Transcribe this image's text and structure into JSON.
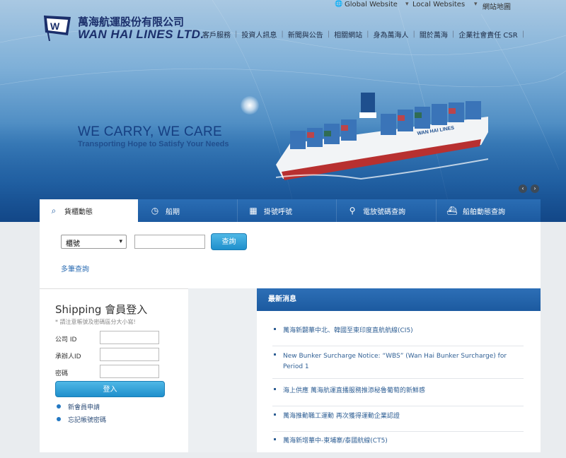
{
  "brand": {
    "name_cn": "萬海航運股份有限公司",
    "name_en": "WAN HAI LINES LTD."
  },
  "utility": {
    "global": "Global Website",
    "local": "Local Websites",
    "sitemap": "網站地圖"
  },
  "nav": [
    "客戶服務",
    "投資人訊息",
    "新聞與公告",
    "相關網站",
    "身為萬海人",
    "關於萬海",
    "企業社會責任 CSR"
  ],
  "hero": {
    "tagline": "WE CARRY, WE CARE",
    "subtagline": "Transporting Hope to Satisfy Your Needs",
    "ship_label": "WAN HAI LINES",
    "prev": "‹",
    "next": "›"
  },
  "tabs": [
    {
      "label": "貨櫃動態",
      "icon": "container-search-icon"
    },
    {
      "label": "船期",
      "icon": "clock-icon"
    },
    {
      "label": "掛號呼號",
      "icon": "grid-icon"
    },
    {
      "label": "電放號碼查詢",
      "icon": "magnifier-icon"
    },
    {
      "label": "船舶動態查詢",
      "icon": "ship-icon"
    }
  ],
  "search": {
    "select_value": "櫃號",
    "input_value": "",
    "button": "查詢",
    "multi_link": "多筆查詢"
  },
  "login": {
    "title": "Shipping 會員登入",
    "note": "* 請注意帳號及密碼區分大小寫!",
    "company_label": "公司 ID",
    "user_label": "承辦人ID",
    "password_label": "密碼",
    "button": "登入",
    "register": "新會員申請",
    "forgot": "忘記帳號密碼"
  },
  "news": {
    "title": "最新消息",
    "items": [
      "萬海新闢華中北、韓國至東印度直航航線(CI5)",
      "New Bunker Surcharge Notice: “WBS” (Wan Hai Bunker Surcharge) for Period 1",
      "海上供應 萬海航運直播服務推添秘魯葡萄的新鮮感",
      "萬海推動職工運動 再次獲得運動企業認證",
      "萬海新增華中-東埔寨/泰國航線(CT5)"
    ]
  },
  "colors": {
    "primary_blue": "#1c5aa0",
    "button_blue": "#1f8fcc",
    "brand_navy": "#1b2f6b"
  }
}
